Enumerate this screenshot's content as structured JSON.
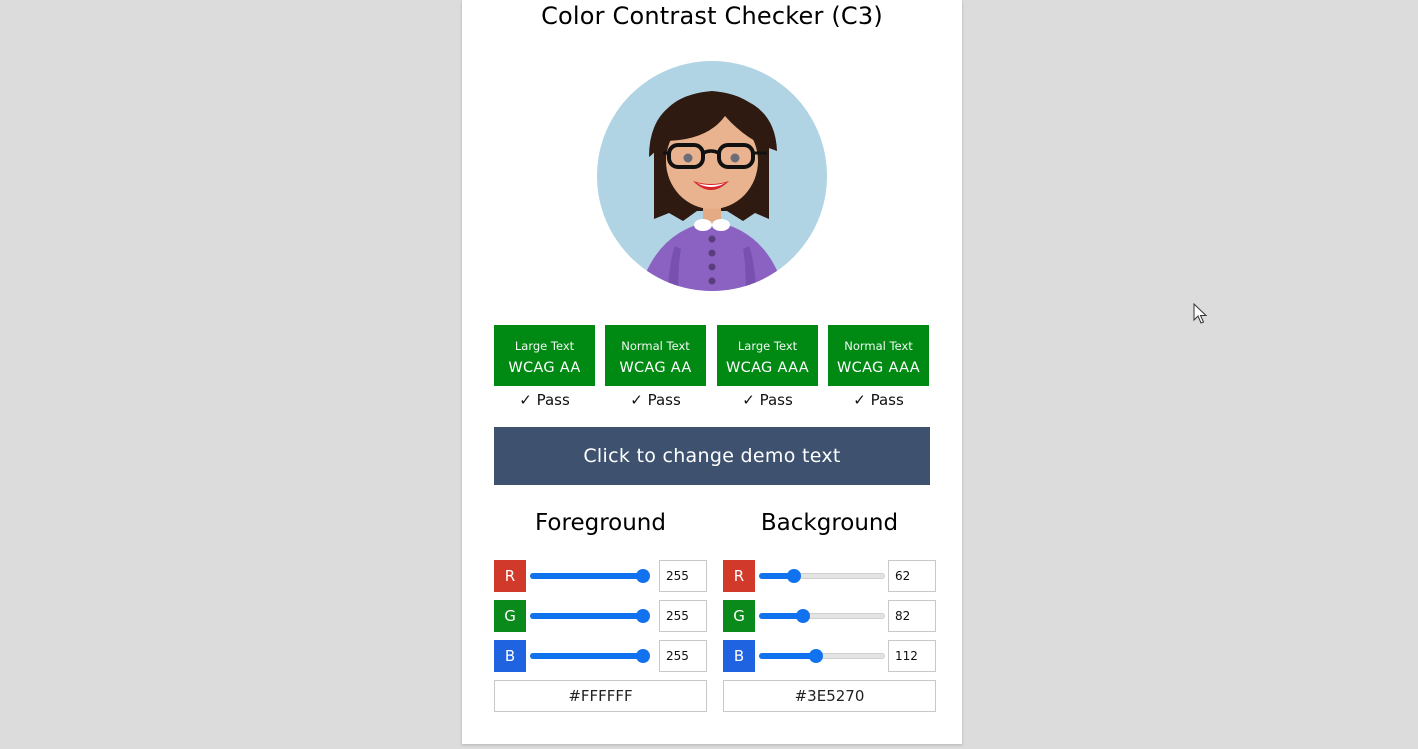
{
  "app": {
    "title": "Color Contrast Checker (C3)"
  },
  "results": [
    {
      "size": "Large Text",
      "level": "WCAG AA",
      "status": "✓ Pass"
    },
    {
      "size": "Normal Text",
      "level": "WCAG AA",
      "status": "✓ Pass"
    },
    {
      "size": "Large Text",
      "level": "WCAG AAA",
      "status": "✓ Pass"
    },
    {
      "size": "Normal Text",
      "level": "WCAG AAA",
      "status": "✓ Pass"
    }
  ],
  "demo": {
    "label": "Click to change demo text",
    "bg": "#3E5270",
    "fg": "#FFFFFF"
  },
  "foreground": {
    "heading": "Foreground",
    "channels": [
      {
        "label": "R",
        "value": 255
      },
      {
        "label": "G",
        "value": 255
      },
      {
        "label": "B",
        "value": 255
      }
    ],
    "hex": "#FFFFFF"
  },
  "background": {
    "heading": "Background",
    "channels": [
      {
        "label": "R",
        "value": 62
      },
      {
        "label": "G",
        "value": 82
      },
      {
        "label": "B",
        "value": 112
      }
    ],
    "hex": "#3E5270"
  },
  "colors": {
    "pass_green": "#008A14",
    "slider_blue": "#1172F0",
    "red_chip": "#D13A2A",
    "green_chip": "#0A8A1A",
    "blue_chip": "#1F63E0"
  },
  "icons": {
    "avatar": "woman-with-glasses-avatar",
    "cursor": "mouse-pointer-icon"
  }
}
